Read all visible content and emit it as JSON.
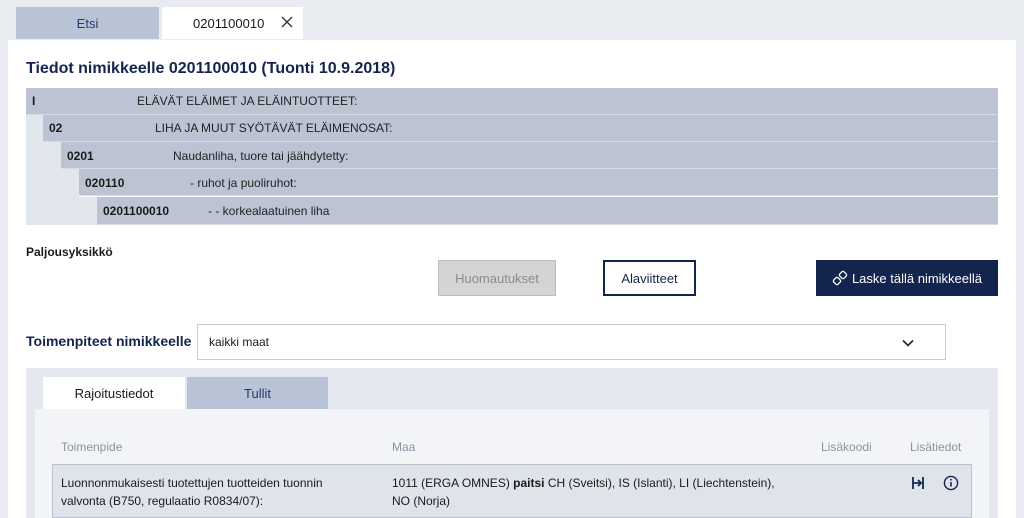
{
  "tabs": {
    "search": "Etsi",
    "item": "0201100010"
  },
  "title": "Tiedot nimikkeelle 0201100010 (Tuonti 10.9.2018)",
  "hierarchy": [
    {
      "code": "I",
      "desc": "ELÄVÄT ELÄIMET JA ELÄINTUOTTEET:"
    },
    {
      "code": "02",
      "desc": "LIHA JA MUUT SYÖTÄVÄT ELÄIMENOSAT:"
    },
    {
      "code": "0201",
      "desc": "Naudanliha, tuore tai jäähdytetty:"
    },
    {
      "code": "020110",
      "desc": "- ruhot ja puoliruhot:"
    },
    {
      "code": "0201100010",
      "desc": "- - korkealaatuinen liha"
    }
  ],
  "quantity_unit_label": "Paljousyksikkö",
  "buttons": {
    "notes": "Huomautukset",
    "footnotes": "Alaviitteet",
    "calculate": "Laske tällä nimikkeellä"
  },
  "measures": {
    "label": "Toimenpiteet nimikkeelle",
    "selected": "kaikki maat"
  },
  "subtabs": {
    "restrictions": "Rajoitustiedot",
    "duties": "Tullit"
  },
  "table": {
    "headers": [
      "Toimenpide",
      "Maa",
      "Lisäkoodi",
      "Lisätiedot"
    ],
    "row": {
      "measure_line1": "Luonnonmukaisesti tuotettujen tuotteiden tuonnin",
      "measure_line2": "valvonta (B750, regulaatio R0834/07):",
      "country_prefix": "1011 (ERGA OMNES) ",
      "country_bold": "paitsi",
      "country_rest": " CH (Sveitsi), IS (Islanti), LI (Liechtenstein),",
      "country_line2": "NO (Norja)"
    }
  },
  "icons": {
    "close": "close-icon",
    "chevron": "chevron-down-icon",
    "link": "link-icon",
    "transfer": "transfer-icon",
    "info": "info-icon"
  },
  "colors": {
    "navy": "#13254f",
    "tab_inactive": "#b8c3d6",
    "hierarchy": "#bcc4d4"
  }
}
